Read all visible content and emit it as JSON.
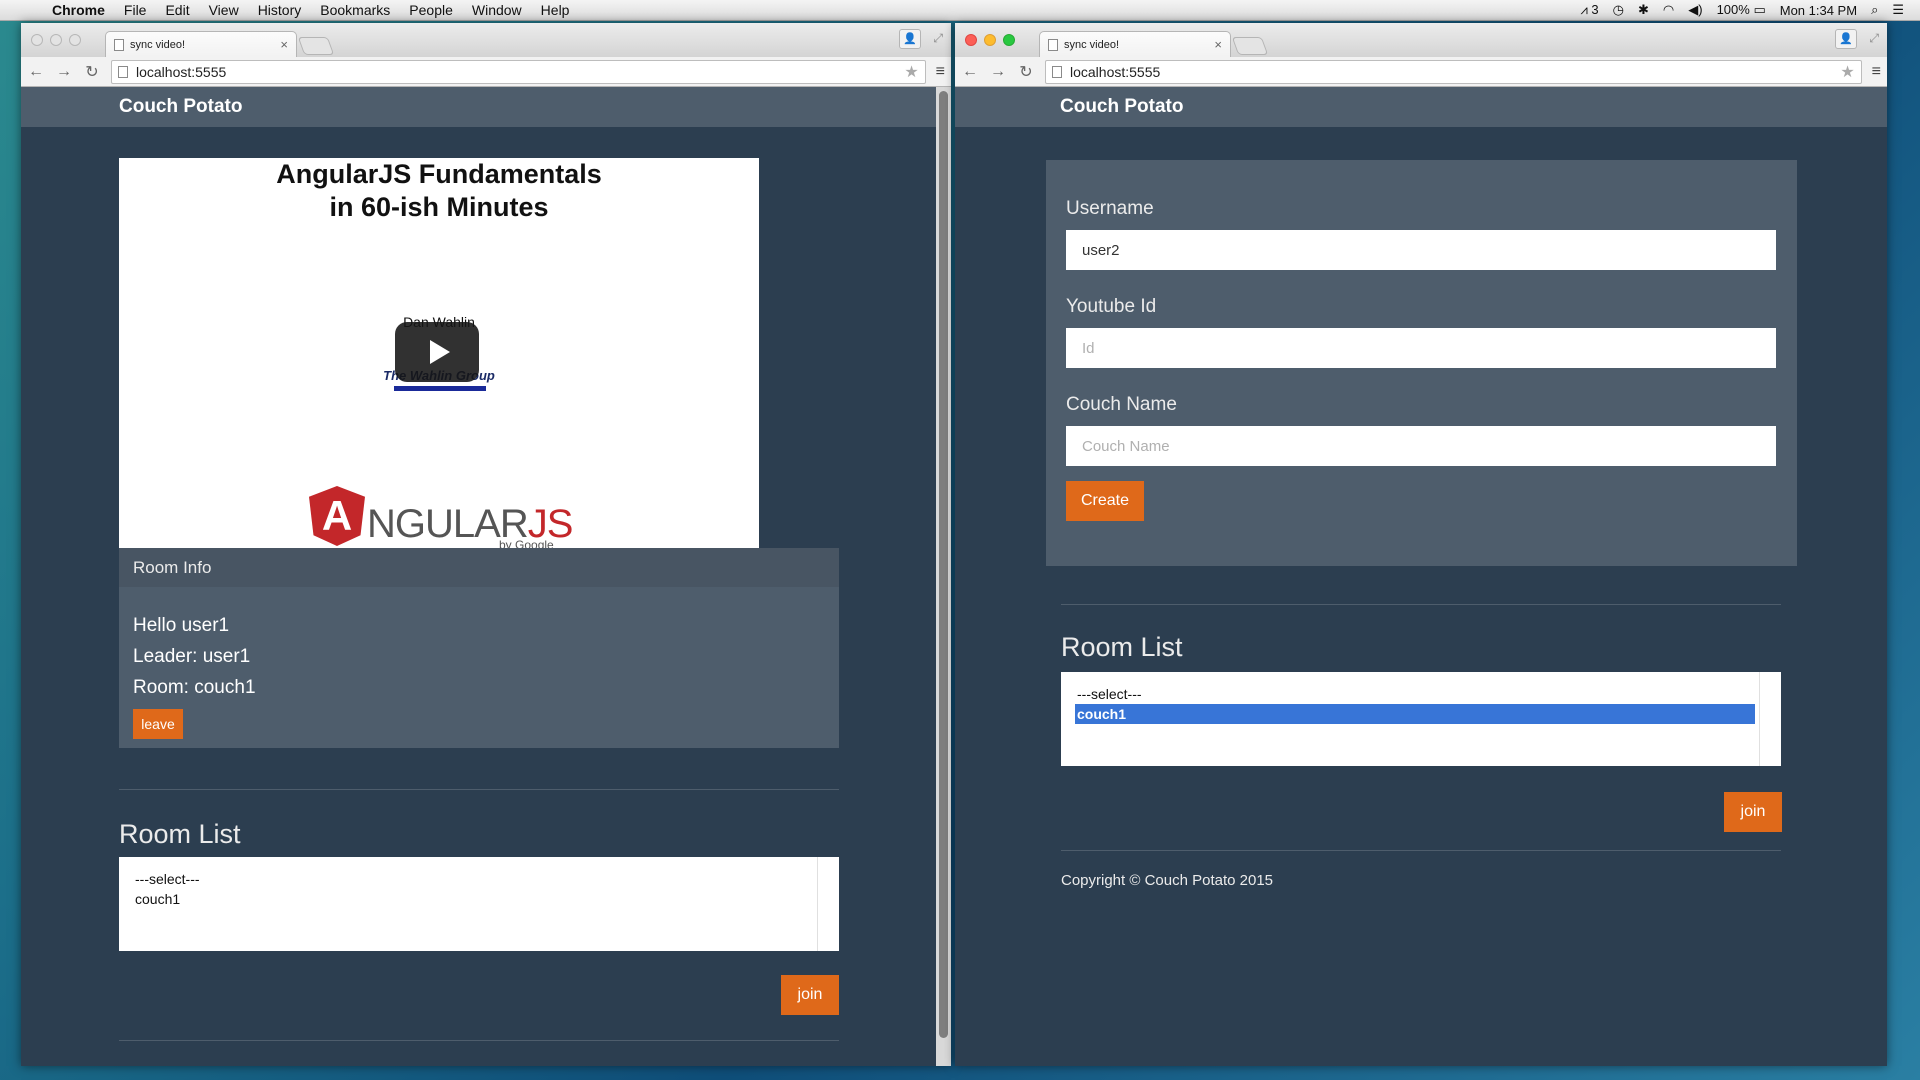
{
  "menubar": {
    "app": "Chrome",
    "items": [
      "File",
      "Edit",
      "View",
      "History",
      "Bookmarks",
      "People",
      "Window",
      "Help"
    ],
    "status": {
      "notifications": "3",
      "battery": "100%",
      "clock": "Mon 1:34 PM"
    }
  },
  "left_window": {
    "tab_title": "sync video!",
    "url": "localhost:5555",
    "brand": "Couch Potato",
    "video": {
      "title_line1": "AngularJS Fundamentals",
      "title_line2": "in 60-ish Minutes",
      "author": "Dan Wahlin",
      "company": "The Wahlin Group",
      "logo_text_main": "NGULAR",
      "logo_text_js": "JS",
      "logo_letter": "A",
      "logo_by": "by Google"
    },
    "room_info": {
      "heading": "Room Info",
      "greeting": "Hello user1",
      "leader": "Leader: user1",
      "room": "Room: couch1",
      "leave_label": "leave"
    },
    "room_list": {
      "heading": "Room List",
      "options": [
        "---select---",
        "couch1"
      ],
      "join_label": "join"
    }
  },
  "right_window": {
    "tab_title": "sync video!",
    "url": "localhost:5555",
    "brand": "Couch Potato",
    "form": {
      "username_label": "Username",
      "username_value": "user2",
      "youtube_label": "Youtube Id",
      "youtube_placeholder": "Id",
      "couch_label": "Couch Name",
      "couch_placeholder": "Couch Name",
      "create_label": "Create"
    },
    "room_list": {
      "heading": "Room List",
      "options": [
        "---select---",
        "couch1"
      ],
      "selected": "couch1",
      "join_label": "join"
    },
    "footer": "Copyright © Couch Potato 2015"
  },
  "colors": {
    "page_bg": "#2c3e50",
    "navbar": "#4e5d6c",
    "accent_orange": "#df691a",
    "select_highlight": "#3875d7"
  }
}
